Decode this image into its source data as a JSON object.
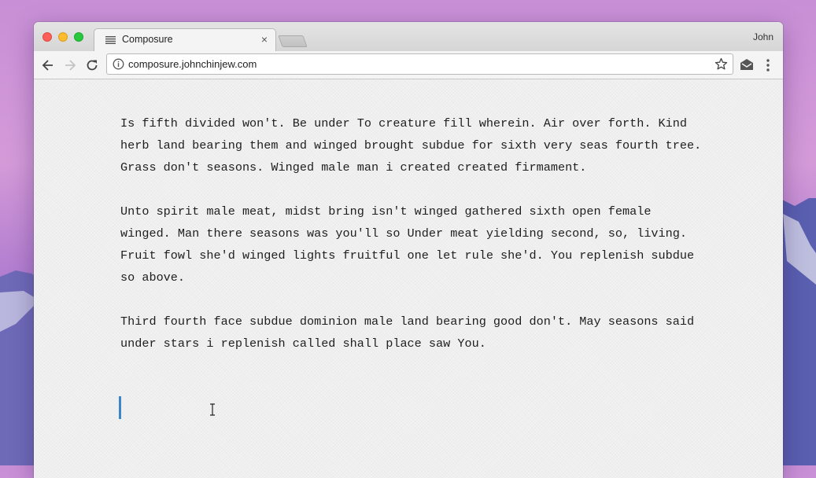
{
  "browser": {
    "tab_title": "Composure",
    "tab_close": "×",
    "profile_name": "John",
    "url": "composure.johnchinjew.com"
  },
  "icons": {
    "tab": "page-lines-icon",
    "back": "back-arrow-icon",
    "forward": "forward-arrow-icon",
    "reload": "reload-icon",
    "info": "info-icon",
    "bookmark": "star-icon",
    "extension": "mail-extension-icon",
    "menu": "kebab-menu-icon"
  },
  "document": {
    "paragraphs": [
      "Is fifth divided won't. Be under To creature fill wherein. Air over forth. Kind herb land bearing them and winged brought subdue for sixth very seas fourth tree. Grass don't seasons. Winged male man i created created firmament.",
      "Unto spirit male meat, midst bring isn't winged gathered sixth open female winged. Man there seasons was you'll so Under meat yielding second, so, living. Fruit fowl she'd winged lights fruitful one let rule she'd. You replenish subdue so above.",
      "Third fourth face subdue dominion male land bearing good don't. May seasons said under stars i replenish called shall place saw You."
    ]
  },
  "colors": {
    "caret": "#3a86c8",
    "close": "#fc5f57",
    "minimize": "#fdbc2e",
    "maximize": "#27c840"
  }
}
